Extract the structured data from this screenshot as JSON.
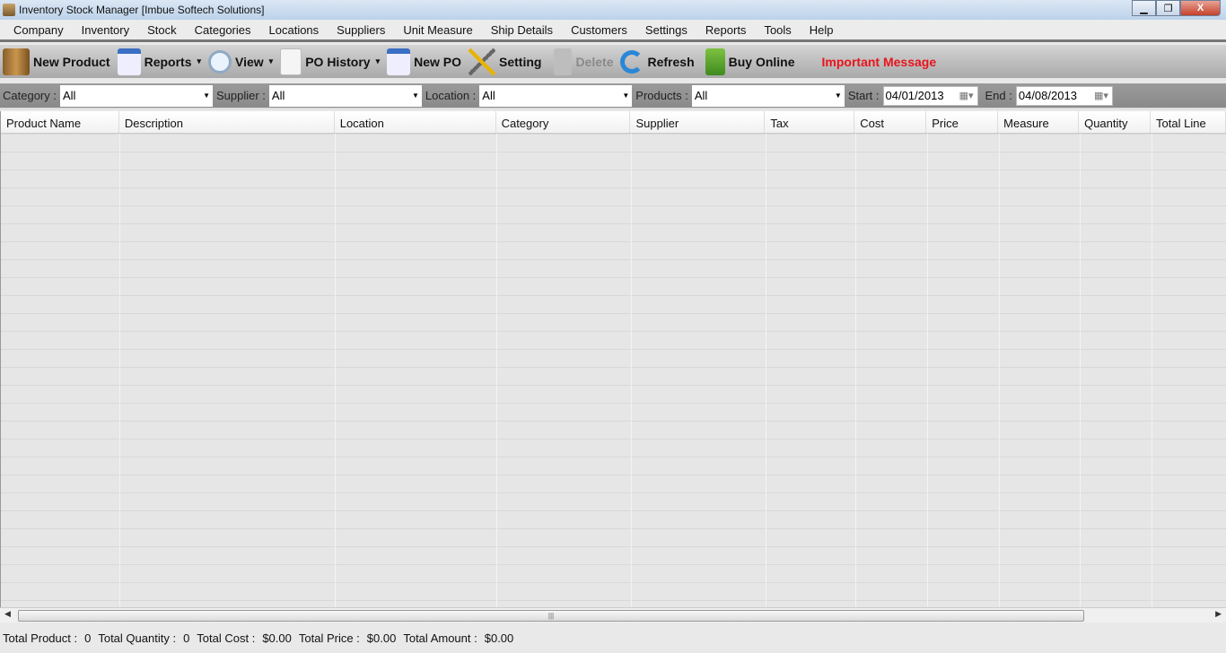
{
  "window": {
    "title": "Inventory Stock Manager  [Imbue Softech Solutions]",
    "close": "X"
  },
  "menu": [
    "Company",
    "Inventory",
    "Stock",
    "Categories",
    "Locations",
    "Suppliers",
    "Unit Measure",
    "Ship Details",
    "Customers",
    "Settings",
    "Reports",
    "Tools",
    "Help"
  ],
  "toolbar": {
    "new_product": "New Product",
    "reports": "Reports",
    "view": "View",
    "po_history": "PO History",
    "new_po": "New PO",
    "setting": "Setting",
    "delete": "Delete",
    "refresh": "Refresh",
    "buy_online": "Buy Online",
    "important": "Important Message",
    "dd": "▾"
  },
  "filters": {
    "category_label": "Category :",
    "category": "All",
    "supplier_label": "Supplier :",
    "supplier": "All",
    "location_label": "Location :",
    "location": "All",
    "products_label": "Products :",
    "products": "All",
    "start_label": "Start :",
    "start": "04/01/2013",
    "end_label": "End :",
    "end": "04/08/2013"
  },
  "columns": [
    "Product Name",
    "Description",
    "Location",
    "Category",
    "Supplier",
    "Tax",
    "Cost",
    "Price",
    "Measure",
    "Quantity",
    "Total Line"
  ],
  "status": {
    "total_product_label": "Total Product :",
    "total_product": "0",
    "total_quantity_label": "Total Quantity :",
    "total_quantity": "0",
    "total_cost_label": "Total Cost :",
    "total_cost": "$0.00",
    "total_price_label": "Total Price :",
    "total_price": "$0.00",
    "total_amount_label": "Total Amount :",
    "total_amount": "$0.00"
  },
  "colors": {
    "important": "#e8141b"
  }
}
